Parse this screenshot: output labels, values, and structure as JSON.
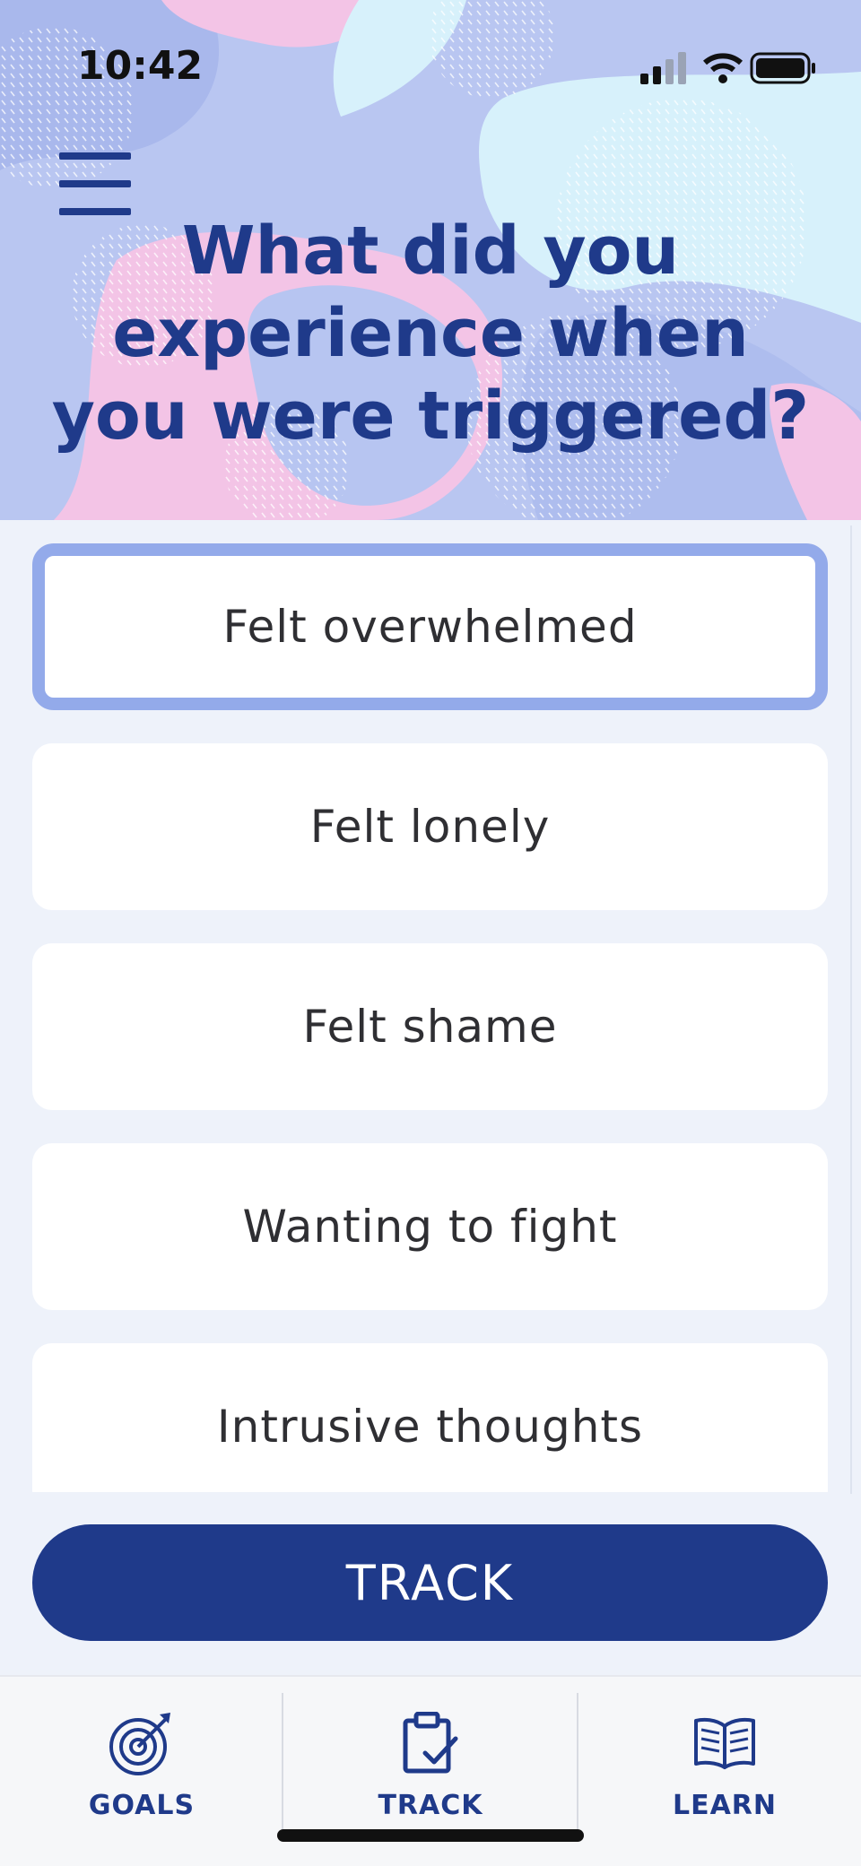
{
  "status_bar": {
    "time": "10:42"
  },
  "header": {
    "title": "What did you experience when you were triggered?"
  },
  "options": [
    {
      "label": "Felt overwhelmed",
      "selected": true
    },
    {
      "label": "Felt lonely",
      "selected": false
    },
    {
      "label": "Felt shame",
      "selected": false
    },
    {
      "label": "Wanting to fight",
      "selected": false
    },
    {
      "label": "Intrusive thoughts",
      "selected": false
    }
  ],
  "action": {
    "track_label": "TRACK"
  },
  "tabs": [
    {
      "label": "GOALS",
      "icon": "target-icon"
    },
    {
      "label": "TRACK",
      "icon": "clipboard-check-icon"
    },
    {
      "label": "LEARN",
      "icon": "open-book-icon"
    }
  ],
  "colors": {
    "primary": "#1f3a8a",
    "selected_border": "#93aaea",
    "background": "#eef2fa"
  }
}
